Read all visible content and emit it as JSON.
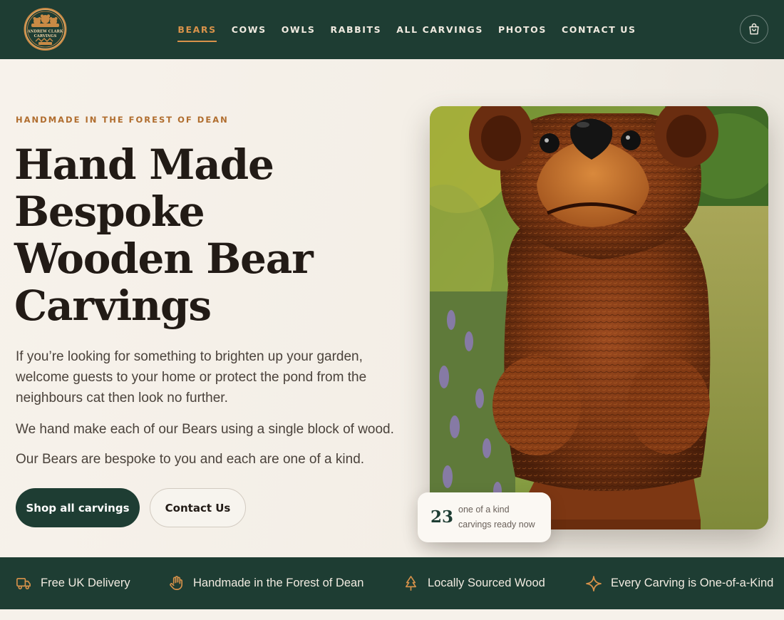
{
  "brand": {
    "logo_text_line1": "ANDREW CLARK",
    "logo_text_line2": "CARVINGS"
  },
  "nav": {
    "items": [
      {
        "label": "BEARS",
        "active": true
      },
      {
        "label": "COWS",
        "active": false
      },
      {
        "label": "OWLS",
        "active": false
      },
      {
        "label": "RABBITS",
        "active": false
      },
      {
        "label": "ALL CARVINGS",
        "active": false
      },
      {
        "label": "PHOTOS",
        "active": false
      },
      {
        "label": "CONTACT US",
        "active": false
      }
    ],
    "cart_icon": "shopping-bag-icon"
  },
  "hero": {
    "eyebrow": "HANDMADE IN THE FOREST OF DEAN",
    "headline_lines": [
      "Hand Made",
      "Bespoke",
      "Wooden Bear",
      "Carvings"
    ],
    "paragraph_1": "If you’re looking for something to brighten up your garden, welcome guests to your home or protect the pond from the neighbours cat then look no further.",
    "paragraph_2": "We hand make each of our Bears using a single block of wood.",
    "paragraph_3": "Our Bears are bespoke to you and each are one of a kind.",
    "primary_button": "Shop all carvings",
    "secondary_button": "Contact Us",
    "stat": {
      "number": "23",
      "label_line1": "one of a kind",
      "label_line2": "carvings ready now"
    }
  },
  "features": [
    {
      "icon": "delivery-truck-icon",
      "label": "Free UK Delivery"
    },
    {
      "icon": "hand-icon",
      "label": "Handmade in the Forest of Dean"
    },
    {
      "icon": "tree-icon",
      "label": "Locally Sourced Wood"
    },
    {
      "icon": "sparkle-icon",
      "label": "Every Carving is One-of-a-Kind"
    }
  ],
  "colors": {
    "header_bg": "#1e3d33",
    "accent": "#d8924a",
    "eyebrow": "#b06d2e",
    "page_bg": "#f6f1ea"
  }
}
